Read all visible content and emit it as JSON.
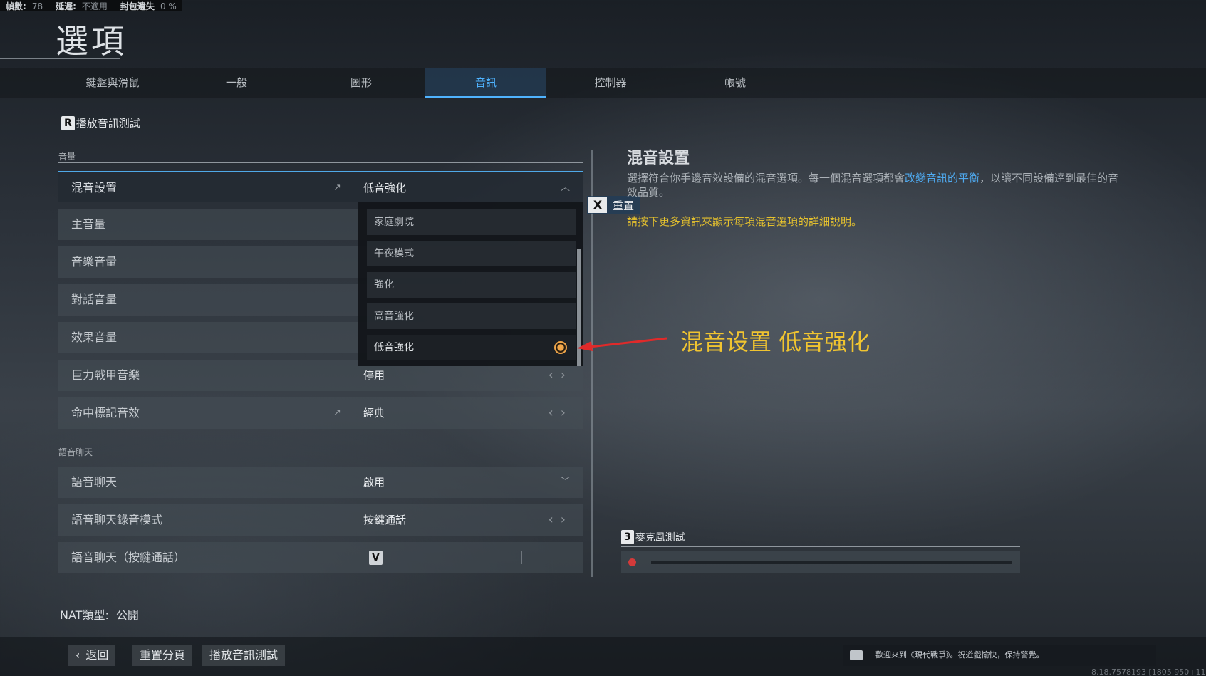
{
  "stats": {
    "fps_label": "幀數:",
    "fps_value": "78",
    "latency_label": "延遲:",
    "latency_value": "不適用",
    "loss_label": "封包遺失",
    "loss_value": "0 %"
  },
  "page_title": "選項",
  "tabs": [
    {
      "label": "鍵盤與滑鼠"
    },
    {
      "label": "一般"
    },
    {
      "label": "圖形"
    },
    {
      "label": "音訊",
      "active": true
    },
    {
      "label": "控制器"
    },
    {
      "label": "帳號"
    }
  ],
  "audio_test": {
    "key": "R",
    "label": "播放音訊測試"
  },
  "sections": {
    "volume": "音量",
    "voice_chat": "語音聊天"
  },
  "rows": {
    "mix": {
      "name": "混音設置",
      "value": "低音強化"
    },
    "master": {
      "name": "主音量"
    },
    "music": {
      "name": "音樂音量"
    },
    "dialogue": {
      "name": "對話音量"
    },
    "effects": {
      "name": "效果音量"
    },
    "juggernaut": {
      "name": "巨力戰甲音樂",
      "value": "停用"
    },
    "hitmarker": {
      "name": "命中標記音效",
      "value": "經典"
    },
    "voice_chat": {
      "name": "語音聊天",
      "value": "啟用"
    },
    "voice_record": {
      "name": "語音聊天錄音模式",
      "value": "按鍵通話"
    },
    "voice_ptt": {
      "name": "語音聊天（按鍵通話）",
      "key": "V"
    }
  },
  "dropdown": {
    "options": [
      "家庭劇院",
      "午夜模式",
      "強化",
      "高音強化",
      "低音強化"
    ],
    "selected": "低音強化"
  },
  "reset": {
    "key": "X",
    "label": "重置"
  },
  "info": {
    "title": "混音設置",
    "desc_before": "選擇符合你手邊音效設備的混音選項。每一個混音選項都會",
    "desc_highlight": "改變音訊的平衡",
    "desc_after": "，以讓不同設備達到最佳的音效品質。",
    "hint": "請按下更多資訊來顯示每項混音選項的詳細說明。"
  },
  "annotation": "混音设置 低音强化",
  "mic_test": {
    "key": "3",
    "label": "麥克風測試"
  },
  "nat": {
    "label": "NAT類型:",
    "value": "公開"
  },
  "bottom": {
    "back": "返回",
    "reset_page": "重置分頁",
    "play_test": "播放音訊測試"
  },
  "chat_message": "歡迎來到《現代戰爭》。祝遊戲愉快，保持警覺。",
  "build": "8.18.7578193 [1805.950+11",
  "colors": {
    "accent": "#4fb3ff",
    "annotation": "#f0c430",
    "hint": "#e5c12e",
    "radio": "#f0a64a"
  }
}
